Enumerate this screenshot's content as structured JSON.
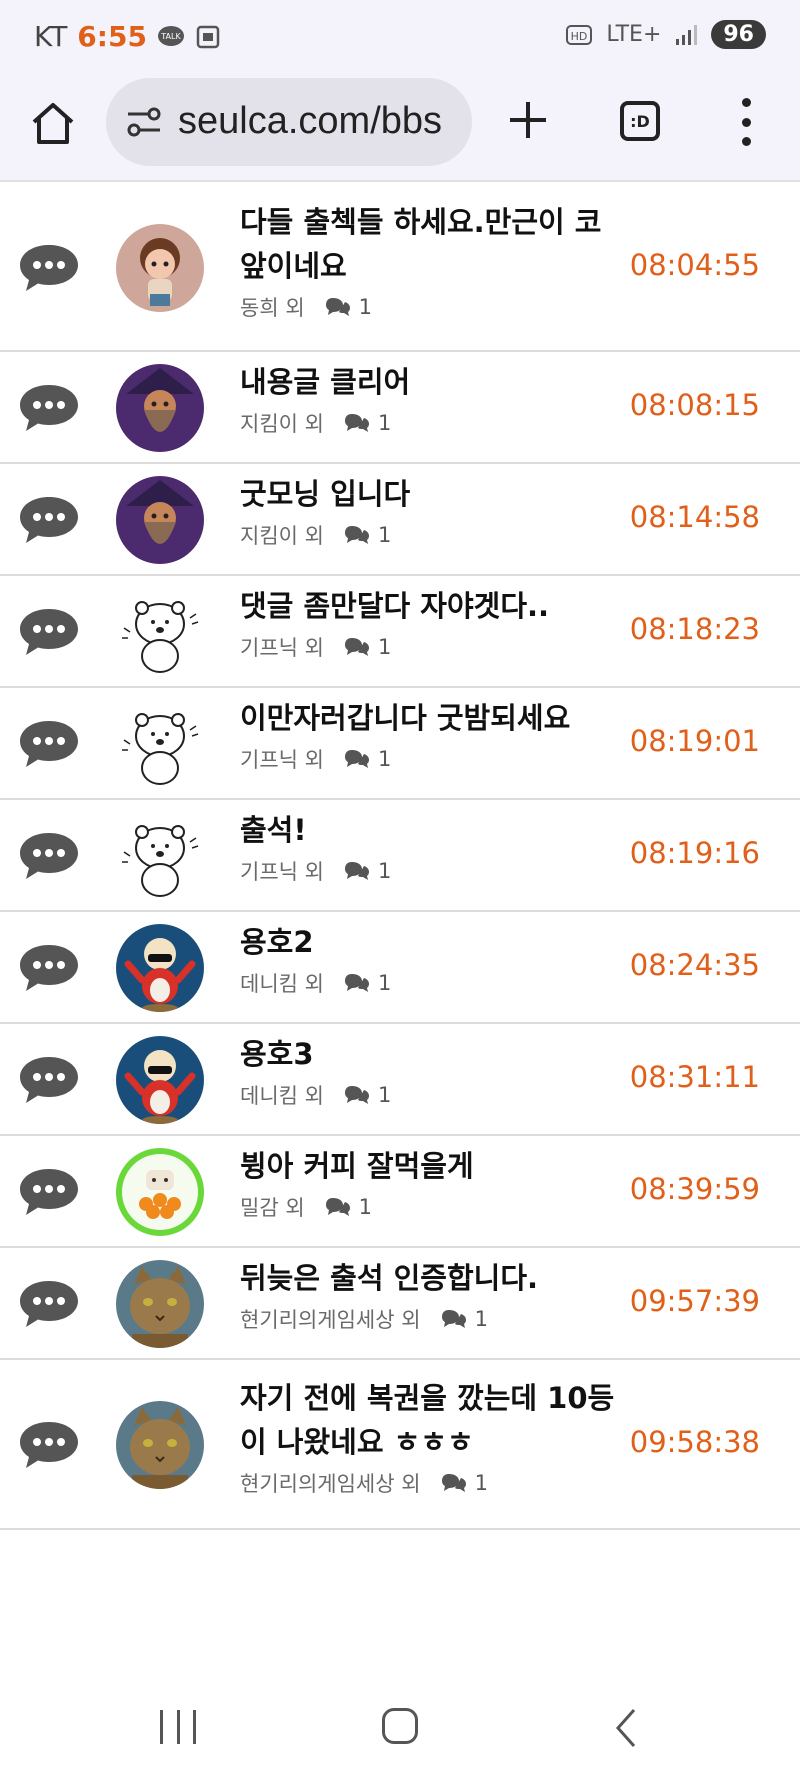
{
  "status_bar": {
    "carrier": "KT",
    "time": "6:55",
    "network": "LTE+",
    "battery": "96"
  },
  "browser": {
    "url": "seulca.com/bbs",
    "tabs_label": ":D"
  },
  "accent_color": "#e0601a",
  "posts": [
    {
      "title": "다들 출첵들 하세요.만근이 코앞이네요",
      "author": "동희 외",
      "comments": "1",
      "time": "08:04:55",
      "avatar": "doll"
    },
    {
      "title": "내용글 클리어",
      "author": "지킴이 외",
      "comments": "1",
      "time": "08:08:15",
      "avatar": "wizard"
    },
    {
      "title": "굿모닝 입니다",
      "author": "지킴이 외",
      "comments": "1",
      "time": "08:14:58",
      "avatar": "wizard"
    },
    {
      "title": "댓글 좀만달다 자야겟다..",
      "author": "기프닉 외",
      "comments": "1",
      "time": "08:18:23",
      "avatar": "bear"
    },
    {
      "title": "이만자러갑니다 굿밤되세요",
      "author": "기프닉 외",
      "comments": "1",
      "time": "08:19:01",
      "avatar": "bear"
    },
    {
      "title": "출석!",
      "author": "기프닉 외",
      "comments": "1",
      "time": "08:19:16",
      "avatar": "bear"
    },
    {
      "title": "용호2",
      "author": "데니킴 외",
      "comments": "1",
      "time": "08:24:35",
      "avatar": "bird"
    },
    {
      "title": "용호3",
      "author": "데니킴 외",
      "comments": "1",
      "time": "08:31:11",
      "avatar": "bird"
    },
    {
      "title": "뷩아 커피 잘먹을게",
      "author": "밀감 외",
      "comments": "1",
      "time": "08:39:59",
      "avatar": "tangerine"
    },
    {
      "title": "뒤늦은 출석 인증합니다.",
      "author": "현기리의게임세상 외",
      "comments": "1",
      "time": "09:57:39",
      "avatar": "cat"
    },
    {
      "title": "자기 전에 복권을 깠는데 10등이 나왔네요 ㅎㅎㅎ",
      "author": "현기리의게임세상 외",
      "comments": "1",
      "time": "09:58:38",
      "avatar": "cat"
    }
  ]
}
